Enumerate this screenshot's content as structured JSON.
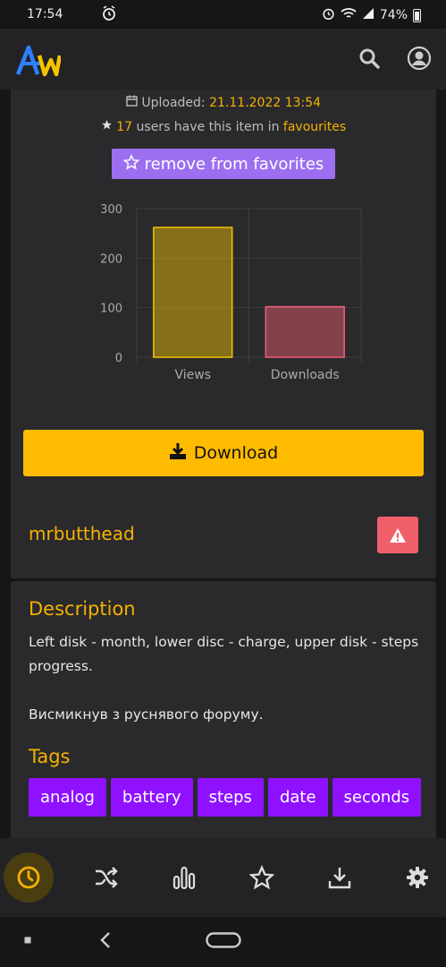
{
  "status": {
    "time": "17:54",
    "battery": "74%"
  },
  "app": {
    "name": "AW",
    "search_icon": "search-icon",
    "profile_icon": "user-circle-icon"
  },
  "item": {
    "uploaded_label": "Uploaded:",
    "uploaded_date": "21.11.2022 13:54",
    "fav_count": "17",
    "fav_text": "users have this item in",
    "fav_link": "favourites",
    "remove_fav_label": "remove from favorites",
    "download_label": "Download"
  },
  "chart_data": {
    "type": "bar",
    "categories": [
      "Views",
      "Downloads"
    ],
    "values": [
      262,
      102
    ],
    "ylim": [
      0,
      300
    ],
    "yticks": [
      "0",
      "100",
      "200",
      "300"
    ],
    "colors": {
      "Views": "#f5c400",
      "Downloads": "#f06070"
    }
  },
  "author": {
    "name": "mrbutthead",
    "report_icon": "warning-icon"
  },
  "description": {
    "title": "Description",
    "line1": "Left disk - month, lower disc - charge, upper disk - steps progress.",
    "line2": "Висмикнув з руснявого форуму."
  },
  "tags": {
    "title": "Tags",
    "items": [
      "analog",
      "battery",
      "steps",
      "date",
      "seconds"
    ]
  },
  "nav": {
    "items": [
      "clock-icon",
      "shuffle-icon",
      "stats-icon",
      "star-icon",
      "download-icon",
      "gear-icon"
    ],
    "active": "clock-icon"
  },
  "colors": {
    "accent": "#f5b100",
    "purple": "#8f11ff",
    "fav_button": "#9b6ff0",
    "danger": "#f0606a"
  }
}
